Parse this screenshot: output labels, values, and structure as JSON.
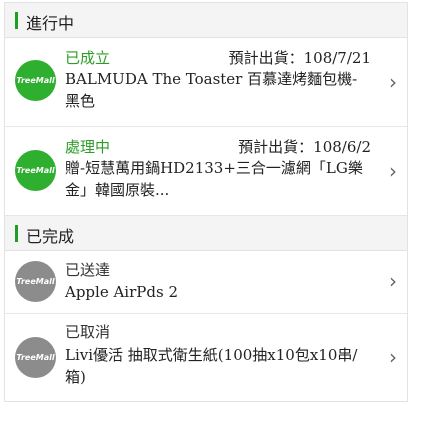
{
  "sections": [
    {
      "title": "進行中",
      "items": [
        {
          "logo_text": "TreeMall",
          "status": "已成立",
          "eta": "預計出貨：108/7/21",
          "name": "BALMUDA The Toaster 百慕達烤麵包機-黑色"
        },
        {
          "logo_text": "TreeMall",
          "status": "處理中",
          "eta": "預計出貨：108/6/2",
          "name": "贈-短慧萬用鍋HD2133+三合一濾網「LG樂金」韓國原裝..."
        }
      ]
    },
    {
      "title": "已完成",
      "items": [
        {
          "logo_text": "TreeMall",
          "status": "已送達",
          "eta": "",
          "name": "Apple AirPds 2"
        },
        {
          "logo_text": "TreeMall",
          "status": "已取消",
          "eta": "",
          "name": "Livi優活 抽取式衛生紙(100抽x10包x10串/箱)"
        }
      ]
    }
  ],
  "icons": {
    "chevron": "chevron-right-icon",
    "logo": "treemall-logo-icon"
  },
  "colors": {
    "accent": "#1e9e22",
    "status_active": "#2d9d26",
    "logo_active": "#2faf30",
    "logo_done": "#8c8c8c"
  }
}
